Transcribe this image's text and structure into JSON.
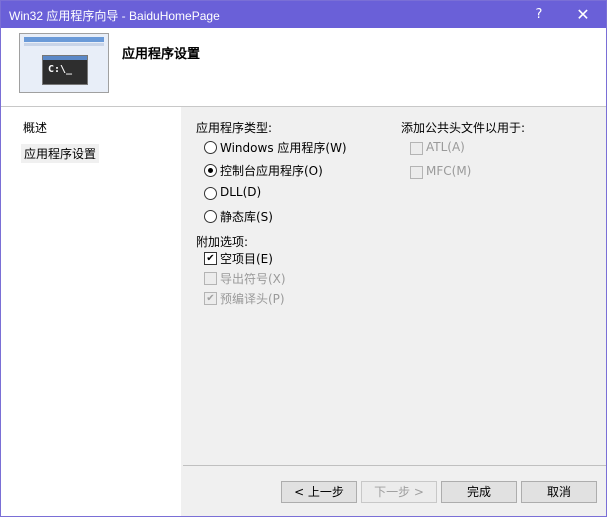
{
  "window": {
    "title": "Win32 应用程序向导 - BaiduHomePage",
    "help_glyph": "?",
    "close_glyph": "✕"
  },
  "header": {
    "title": "应用程序设置",
    "image_text": "C:\\_"
  },
  "sidebar": {
    "items": [
      {
        "label": "概述"
      },
      {
        "label": "应用程序设置"
      }
    ]
  },
  "app_type": {
    "heading": "应用程序类型:",
    "options": [
      {
        "label": "Windows 应用程序(W)",
        "selected": false
      },
      {
        "label": "控制台应用程序(O)",
        "selected": true
      },
      {
        "label": "DLL(D)",
        "selected": false
      },
      {
        "label": "静态库(S)",
        "selected": false
      }
    ]
  },
  "additional": {
    "heading": "附加选项:",
    "options": [
      {
        "label": "空项目(E)",
        "checked": true,
        "enabled": true
      },
      {
        "label": "导出符号(X)",
        "checked": false,
        "enabled": false
      },
      {
        "label": "预编译头(P)",
        "checked": true,
        "enabled": false
      }
    ]
  },
  "common_headers": {
    "heading": "添加公共头文件以用于:",
    "options": [
      {
        "label": "ATL(A)",
        "checked": false,
        "enabled": false
      },
      {
        "label": "MFC(M)",
        "checked": false,
        "enabled": false
      }
    ]
  },
  "buttons": {
    "prev": "< 上一步",
    "next": "下一步 >",
    "finish": "完成",
    "cancel": "取消"
  },
  "check_glyph": "✔"
}
